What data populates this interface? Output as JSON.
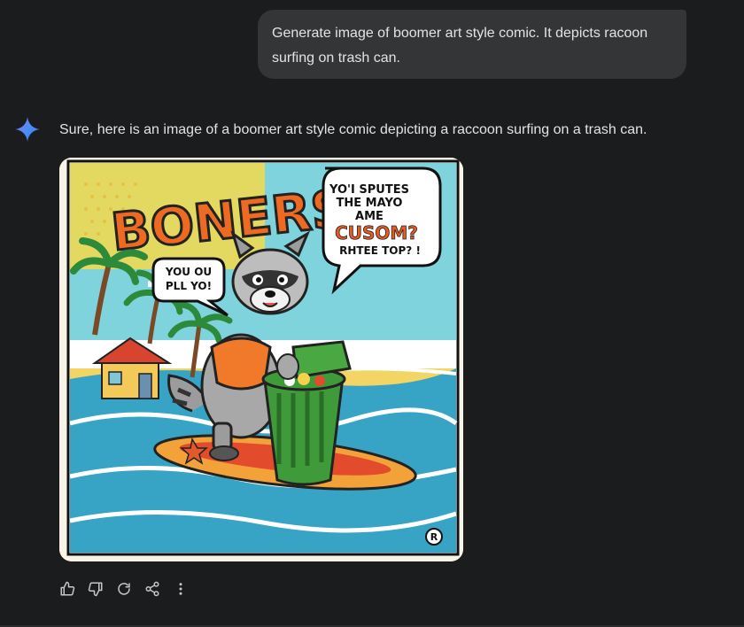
{
  "conversation": {
    "user_message": "Generate image of boomer art style comic. It depicts racoon surfing on trash can.",
    "assistant_message": "Sure, here is an image of a boomer art style comic depicting a raccoon surfing on a trash can.",
    "assistant_icon": "gemini-sparkle-icon"
  },
  "comic": {
    "title": "BONERS",
    "bubble_right": [
      "YO'I SPUTES",
      "THE MAYO",
      "AME",
      "CUSOM?",
      "RHTEE TOP? !"
    ],
    "bubble_left": [
      "YOU OU",
      "PLL YO!"
    ],
    "badge": "R"
  },
  "actions": {
    "icons": [
      "thumbs-up-icon",
      "thumbs-down-icon",
      "regenerate-icon",
      "share-icon",
      "more-vert-icon"
    ]
  },
  "colors": {
    "background": "#1b1c1d",
    "user_bubble": "#333537",
    "text": "#e3e3e3",
    "icon": "#c4c7c5",
    "sparkle_blue": "#4b8df8"
  }
}
